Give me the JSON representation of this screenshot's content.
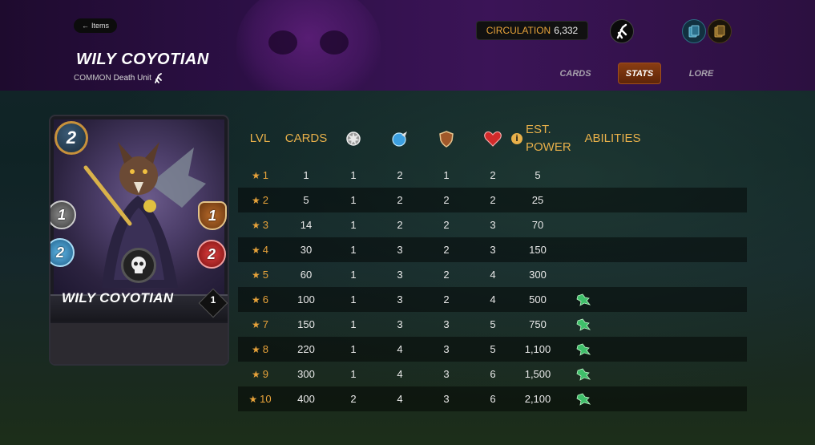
{
  "header": {
    "back_label": "Items",
    "title": "WILY COYOTIAN",
    "rarity": "COMMON",
    "type": "Death Unit",
    "circulation_label": "CIRCULATION",
    "circulation_value": "6,332",
    "tabs": [
      {
        "label": "CARDS",
        "active": false
      },
      {
        "label": "STATS",
        "active": true
      },
      {
        "label": "LORE",
        "active": false
      }
    ]
  },
  "card": {
    "name": "WILY COYOTIAN",
    "mana": "2",
    "attack": "1",
    "armor": "1",
    "speed": "2",
    "health": "2",
    "level": "1"
  },
  "table": {
    "headers": {
      "lvl": "LVL",
      "cards": "CARDS",
      "est_power": "EST. POWER",
      "abilities": "ABILITIES"
    },
    "stat_icons": [
      "attack-icon",
      "speed-icon",
      "armor-icon",
      "health-icon"
    ],
    "rows": [
      {
        "lvl": "1",
        "cards": "1",
        "attack": "1",
        "speed": "2",
        "armor": "1",
        "health": "2",
        "power": "5",
        "ability": false
      },
      {
        "lvl": "2",
        "cards": "5",
        "attack": "1",
        "speed": "2",
        "armor": "2",
        "health": "2",
        "power": "25",
        "ability": false
      },
      {
        "lvl": "3",
        "cards": "14",
        "attack": "1",
        "speed": "2",
        "armor": "2",
        "health": "3",
        "power": "70",
        "ability": false
      },
      {
        "lvl": "4",
        "cards": "30",
        "attack": "1",
        "speed": "3",
        "armor": "2",
        "health": "3",
        "power": "150",
        "ability": false
      },
      {
        "lvl": "5",
        "cards": "60",
        "attack": "1",
        "speed": "3",
        "armor": "2",
        "health": "4",
        "power": "300",
        "ability": false
      },
      {
        "lvl": "6",
        "cards": "100",
        "attack": "1",
        "speed": "3",
        "armor": "2",
        "health": "4",
        "power": "500",
        "ability": true
      },
      {
        "lvl": "7",
        "cards": "150",
        "attack": "1",
        "speed": "3",
        "armor": "3",
        "health": "5",
        "power": "750",
        "ability": true
      },
      {
        "lvl": "8",
        "cards": "220",
        "attack": "1",
        "speed": "4",
        "armor": "3",
        "health": "5",
        "power": "1,100",
        "ability": true
      },
      {
        "lvl": "9",
        "cards": "300",
        "attack": "1",
        "speed": "4",
        "armor": "3",
        "health": "6",
        "power": "1,500",
        "ability": true
      },
      {
        "lvl": "10",
        "cards": "400",
        "attack": "2",
        "speed": "4",
        "armor": "3",
        "health": "6",
        "power": "2,100",
        "ability": true
      }
    ]
  },
  "colors": {
    "accent": "#e8b04a",
    "active_tab": "#8a3d12",
    "header_bg": "#2c0f45"
  }
}
